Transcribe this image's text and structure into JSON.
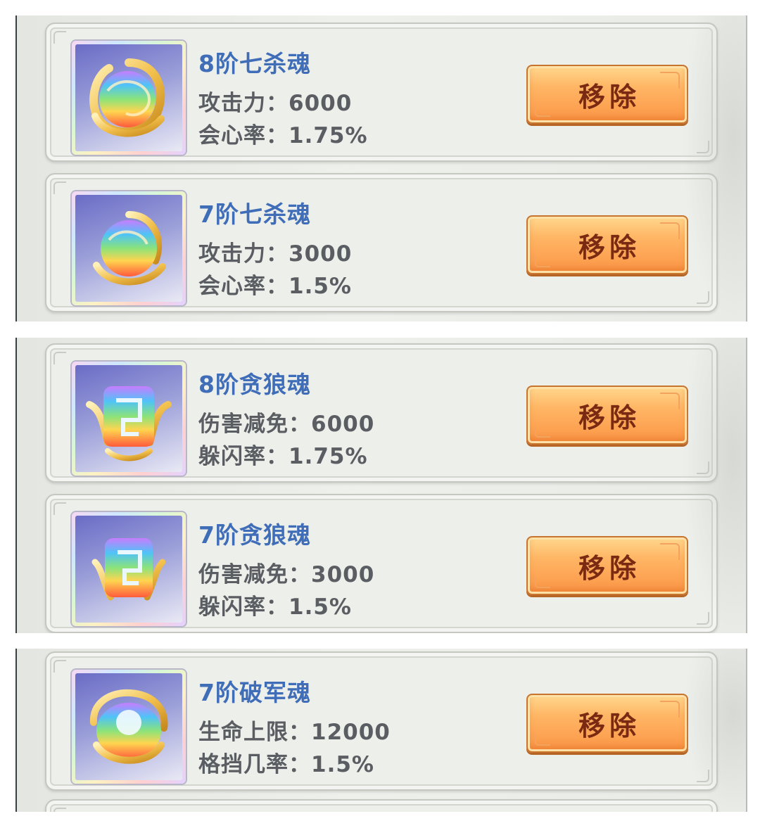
{
  "panels": [
    {
      "cards": [
        {
          "name": "8阶七杀魂",
          "stat1": "攻击力：6000",
          "stat2": "会心率：1.75%",
          "icon": "seven-kill-soul-orb-icon",
          "button": "移除"
        },
        {
          "name": "7阶七杀魂",
          "stat1": "攻击力：3000",
          "stat2": "会心率：1.5%",
          "icon": "seven-kill-soul-orb-icon",
          "button": "移除"
        }
      ]
    },
    {
      "cards": [
        {
          "name": "8阶贪狼魂",
          "stat1": "伤害减免：6000",
          "stat2": "躲闪率：1.75%",
          "icon": "greedy-wolf-soul-rune-icon",
          "button": "移除"
        },
        {
          "name": "7阶贪狼魂",
          "stat1": "伤害减免：3000",
          "stat2": "躲闪率：1.5%",
          "icon": "greedy-wolf-soul-rune-icon",
          "button": "移除"
        }
      ]
    },
    {
      "cards": [
        {
          "name": "7阶破军魂",
          "stat1": "生命上限：12000",
          "stat2": "格挡几率：1.5%",
          "icon": "army-breaker-soul-gem-icon",
          "button": "移除"
        }
      ]
    }
  ],
  "colors": {
    "name_text": "#3f6db8",
    "stat_text": "#5a5e62",
    "button_orange": "#fb9545",
    "button_text": "#7a2a12"
  }
}
